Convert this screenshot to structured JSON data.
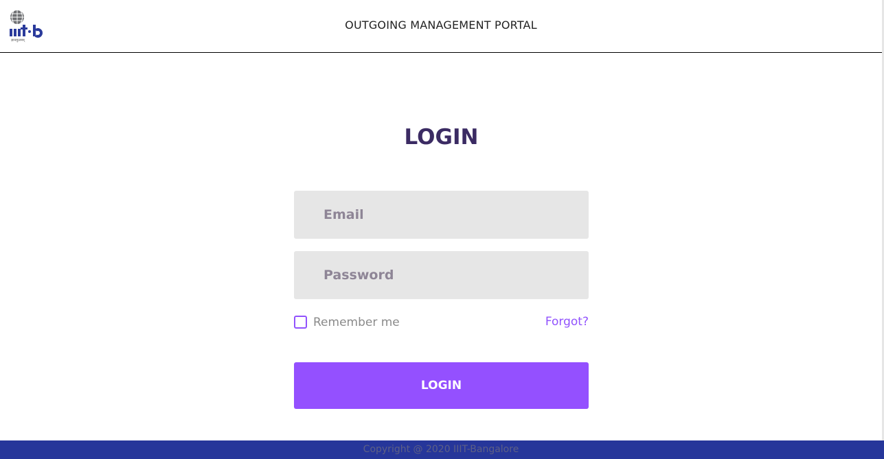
{
  "header": {
    "logo_text": "iiit·b",
    "logo_tagline": "ज्ञानमुत्तमम्",
    "title": "OUTGOING MANAGEMENT PORTAL"
  },
  "login": {
    "heading": "LOGIN",
    "email_placeholder": "Email",
    "password_placeholder": "Password",
    "remember_label": "Remember me",
    "remember_checked": false,
    "forgot_label": "Forgot?",
    "button_label": "LOGIN"
  },
  "footer": {
    "copyright": "Copyright @ 2020 IIIT-Bangalore"
  },
  "colors": {
    "accent": "#9450ff",
    "heading": "#3b2b63",
    "footer_bg": "#26369a",
    "field_bg": "#e6e6e6"
  }
}
